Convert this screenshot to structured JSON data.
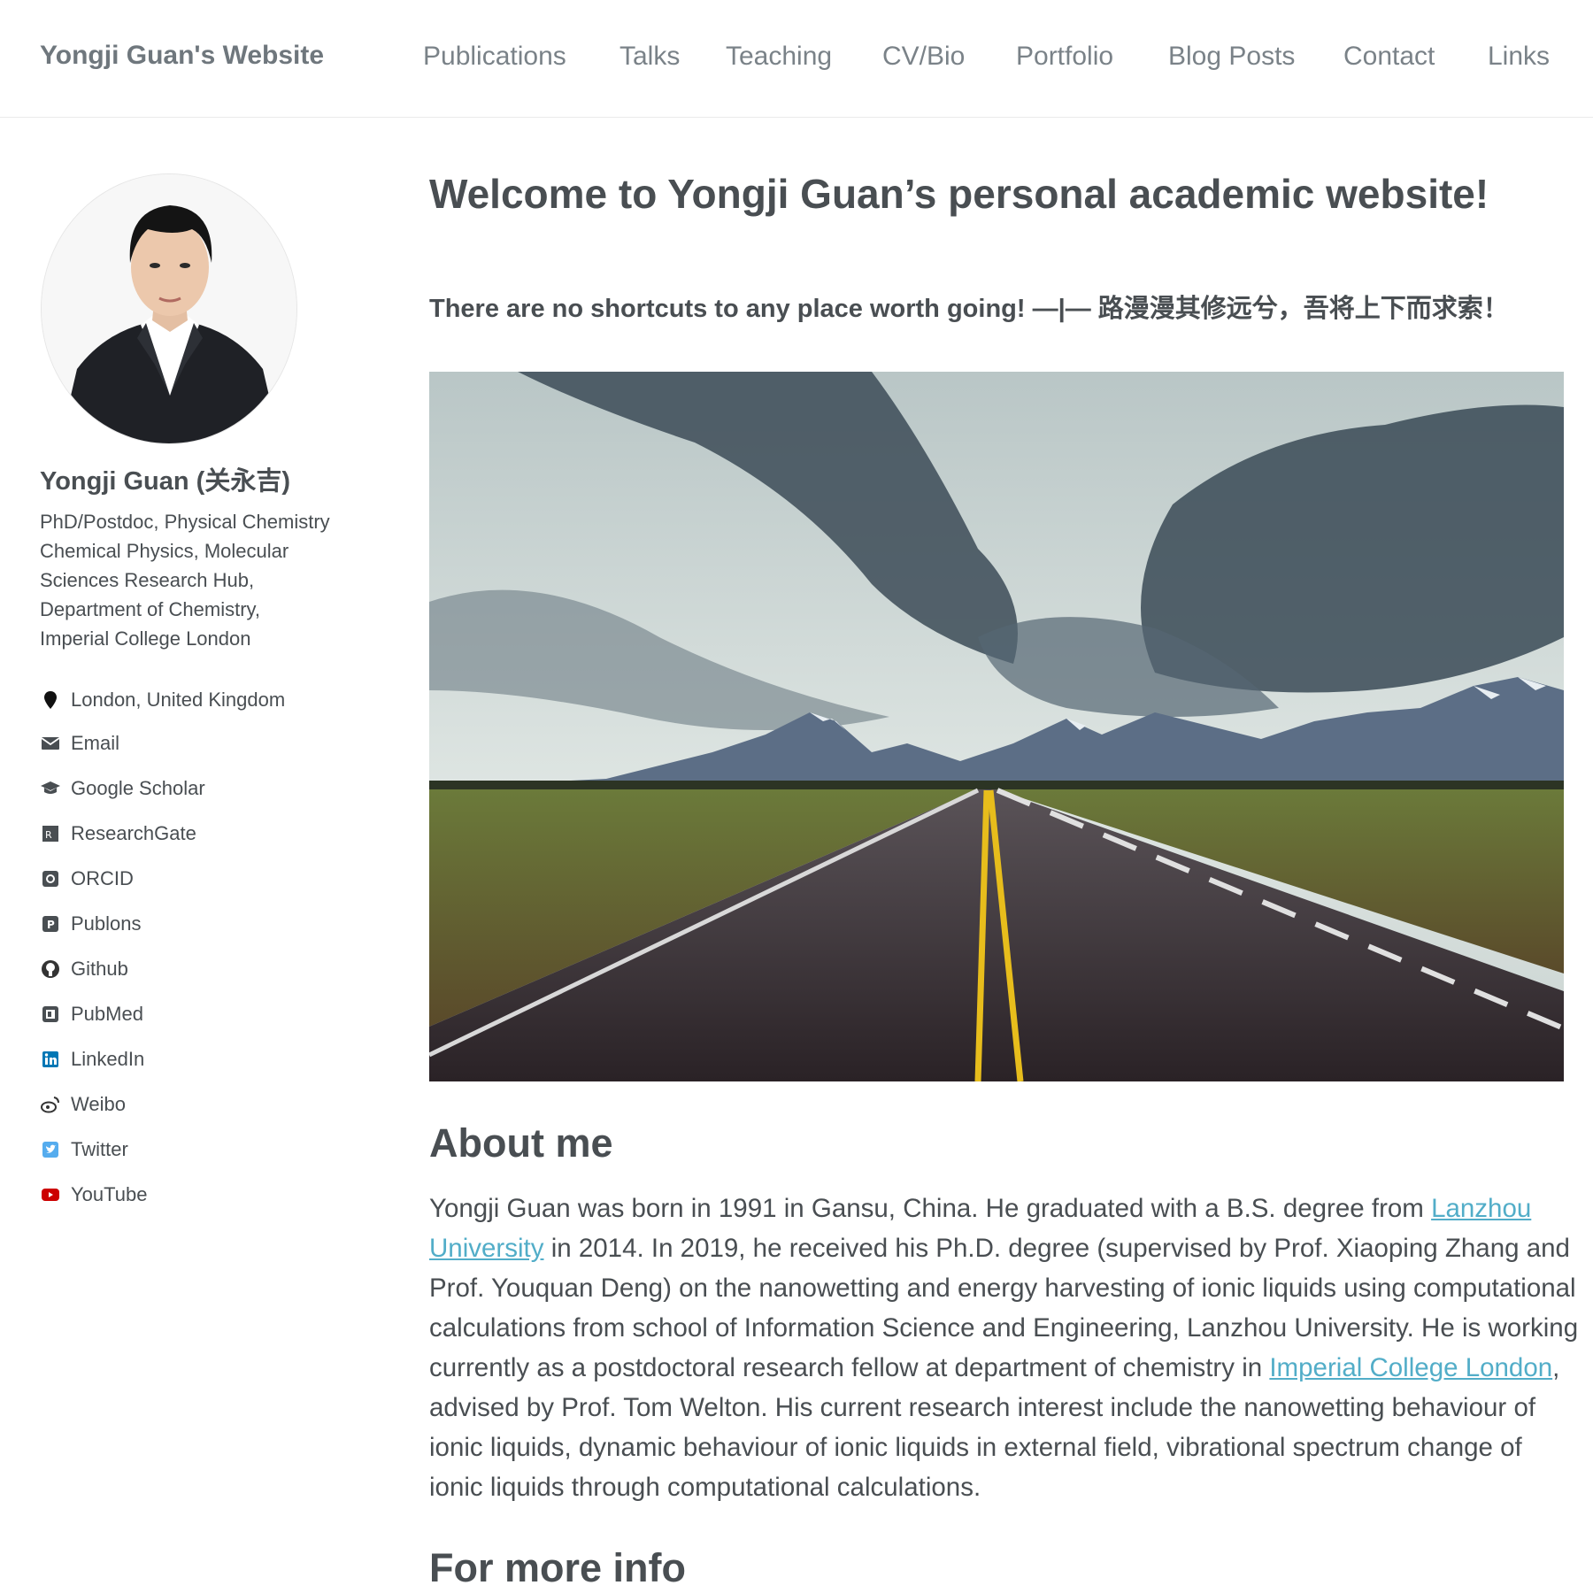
{
  "site": {
    "title": "Yongji Guan's Website"
  },
  "nav": [
    {
      "label": "Publications"
    },
    {
      "label": "Talks"
    },
    {
      "label": "Teaching"
    },
    {
      "label": "CV/Bio"
    },
    {
      "label": "Portfolio"
    },
    {
      "label": "Blog Posts"
    },
    {
      "label": "Contact"
    },
    {
      "label": "Links"
    }
  ],
  "author": {
    "name": "Yongji Guan (关永吉)",
    "bio": "PhD/Postdoc, Physical Chemistry Chemical Physics, Molecular Sciences Research Hub, Department of Chemistry, Imperial College London",
    "location": "London, United Kingdom",
    "links": [
      {
        "label": "Email",
        "icon": "envelope-icon"
      },
      {
        "label": "Google Scholar",
        "icon": "graduation-cap-icon"
      },
      {
        "label": "ResearchGate",
        "icon": "researchgate-icon"
      },
      {
        "label": "ORCID",
        "icon": "orcid-icon"
      },
      {
        "label": "Publons",
        "icon": "publons-icon"
      },
      {
        "label": "Github",
        "icon": "github-icon"
      },
      {
        "label": "PubMed",
        "icon": "pubmed-icon"
      },
      {
        "label": "LinkedIn",
        "icon": "linkedin-icon"
      },
      {
        "label": "Weibo",
        "icon": "weibo-icon"
      },
      {
        "label": "Twitter",
        "icon": "twitter-icon"
      },
      {
        "label": "YouTube",
        "icon": "youtube-icon"
      }
    ]
  },
  "main": {
    "title": "Welcome to Yongji Guan’s personal academic website!",
    "motto": "There are no shortcuts to any place worth going! —|— 路漫漫其修远兮，吾将上下而求索！",
    "about": {
      "heading": "About me",
      "text_1": "Yongji Guan was born in 1991 in Gansu, China. He graduated with a B.S. degree from ",
      "link_1": "Lanzhou University",
      "text_2": " in 2014. In 2019, he received his Ph.D. degree (supervised by Prof. Xiaoping Zhang and Prof. Youquan Deng) on the nanowetting and energy harvesting of ionic liquids using computational calculations from school of Information Science and Engineering, Lanzhou University. He is working currently as a postdoctoral research fellow at department of chemistry in ",
      "link_2": "Imperial College London",
      "text_3": ", advised by Prof. Tom Welton. His current research interest include the nanowetting behaviour of ionic liquids, dynamic behaviour of ionic liquids in external field, vibrational spectrum change of ionic liquids through computational calculations."
    },
    "more": {
      "heading": "For more info"
    }
  },
  "colors": {
    "text": "#494e52",
    "link": "#52adc8",
    "nav": "#7a8288",
    "linkedin": "#0077b5",
    "twitter": "#55acee",
    "youtube": "#cc0000"
  }
}
